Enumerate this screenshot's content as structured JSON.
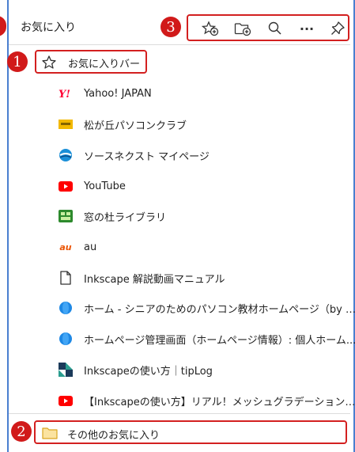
{
  "panel": {
    "title": "お気に入り"
  },
  "toolbar": {
    "badge": "3",
    "buttons": [
      {
        "icon": "add-favorite-icon"
      },
      {
        "icon": "add-folder-icon"
      },
      {
        "icon": "search-icon"
      },
      {
        "icon": "more-icon",
        "glyph": "···"
      },
      {
        "icon": "pin-icon"
      }
    ]
  },
  "favorites_bar": {
    "badge": "1",
    "label": "お気に入りバー"
  },
  "items": [
    {
      "label": "Yahoo! JAPAN",
      "icon": "yahoo-icon"
    },
    {
      "label": "松が丘パソコンクラブ",
      "icon": "club-logo-icon"
    },
    {
      "label": "ソースネクスト マイページ",
      "icon": "sourcenext-icon"
    },
    {
      "label": "YouTube",
      "icon": "youtube-icon"
    },
    {
      "label": "窓の杜ライブラリ",
      "icon": "madonomori-icon"
    },
    {
      "label": "au",
      "icon": "au-icon",
      "glyph": "au"
    },
    {
      "label": "Inkscape 解説動画マニュアル",
      "icon": "page-icon"
    },
    {
      "label": "ホーム - シニアのためのパソコン教材ホームページ（by AI)",
      "icon": "globe-icon"
    },
    {
      "label": "ホームページ管理画面（ホームページ情報）: 個人ホーム...",
      "icon": "globe-icon"
    },
    {
      "label": "Inkscapeの使い方｜tipLog",
      "icon": "tiplog-icon"
    },
    {
      "label": "【Inkscapeの使い方】リアル！メッシュグラデーション大活...",
      "icon": "youtube-icon"
    }
  ],
  "other_favorites": {
    "badge": "2",
    "label": "その他のお気に入り"
  },
  "colors": {
    "accent_red": "#d11a1a",
    "frame_blue": "#4a7fd0"
  }
}
